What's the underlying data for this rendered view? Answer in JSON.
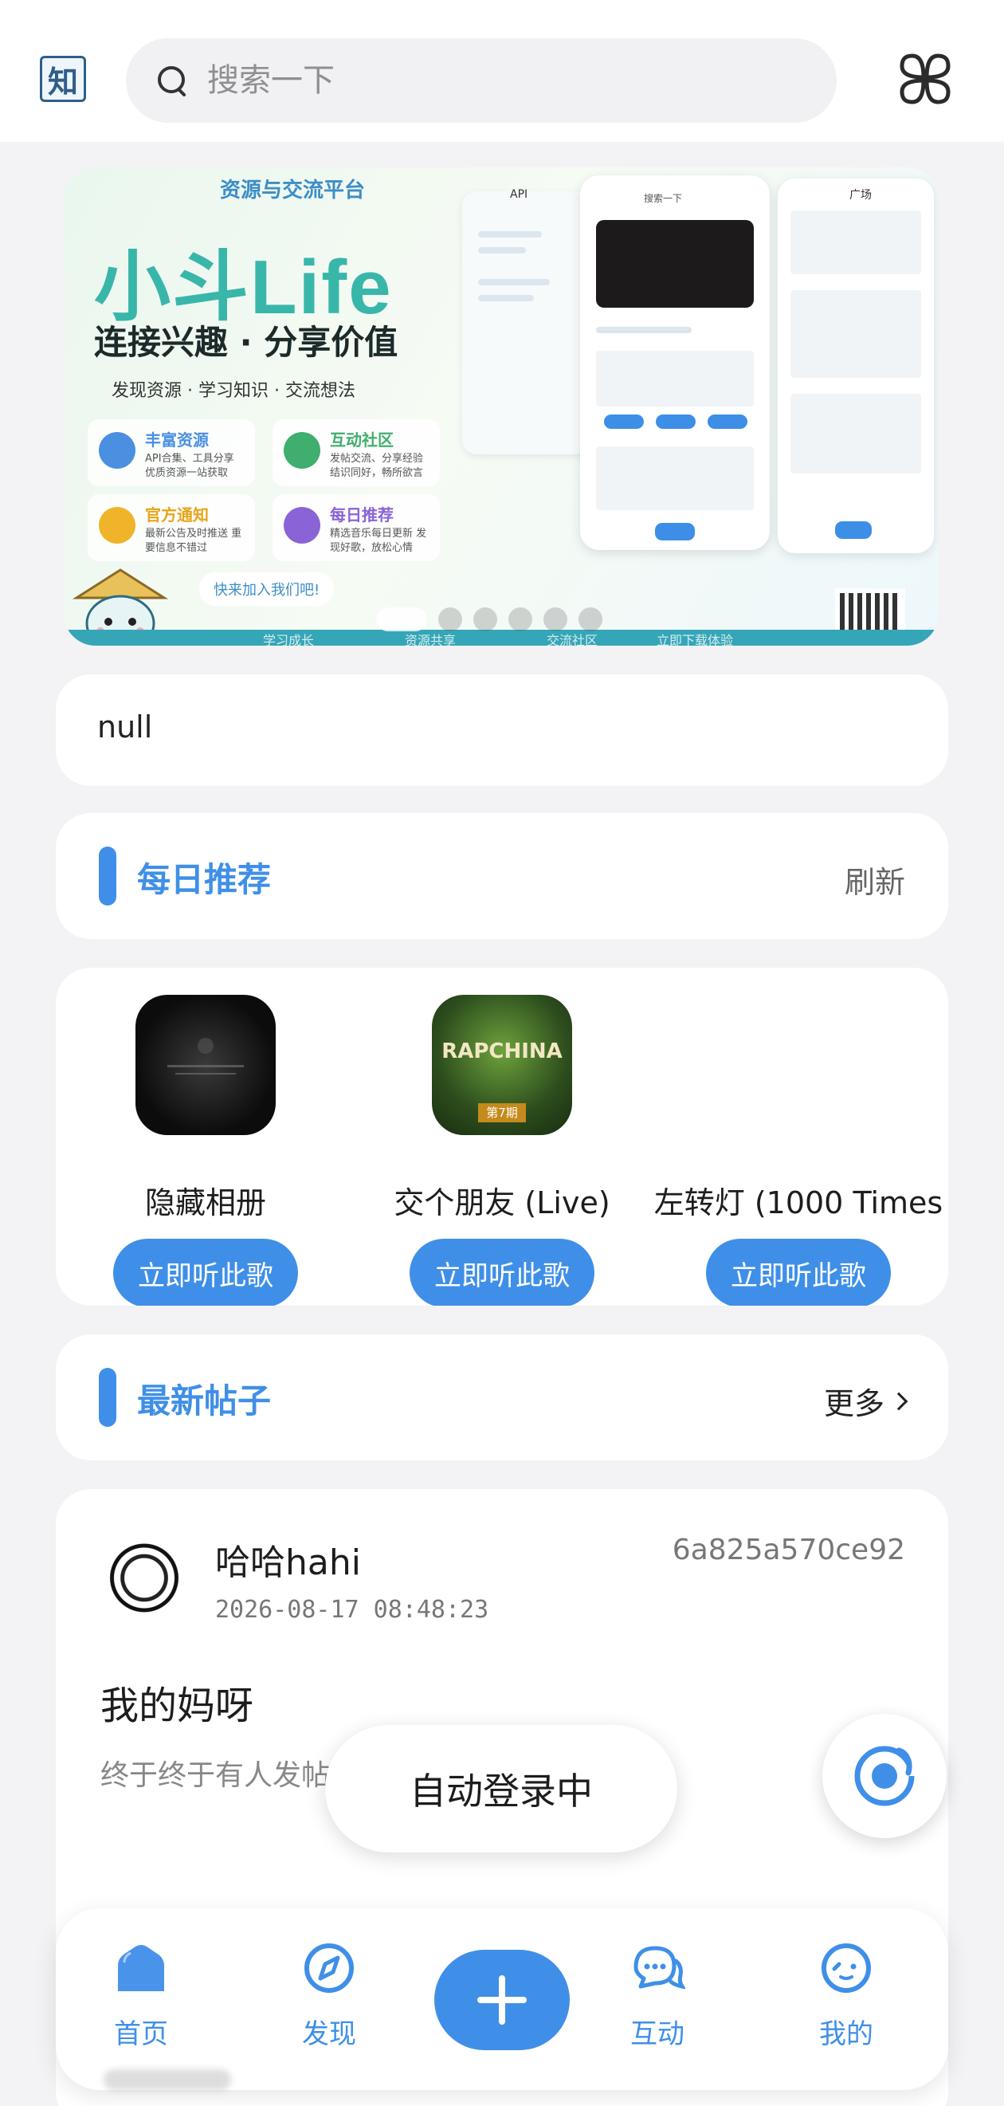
{
  "header": {
    "logo_text": "知",
    "search_placeholder": "搜索一下",
    "grid_icon": "grid-icon"
  },
  "banner": {
    "badge": "资源与交流平台",
    "title": "小斗Life",
    "subtitle": "连接兴趣 · 分享价值",
    "tagline": "发现资源 · 学习知识 · 交流想法",
    "features": [
      {
        "title": "丰富资源",
        "desc": "API合集、工具分享 优质资源一站获取",
        "color": "#4a8fe0"
      },
      {
        "title": "互动社区",
        "desc": "发帖交流、分享经验 结识同好，畅所欲言",
        "color": "#3fae6e"
      },
      {
        "title": "官方通知",
        "desc": "最新公告及时推送 重要信息不错过",
        "color": "#f0b42a"
      },
      {
        "title": "每日推荐",
        "desc": "精选音乐每日更新 发现好歌，放松心情",
        "color": "#8a63d6"
      }
    ],
    "cta": "快来加入我们吧!",
    "bottom_items": [
      "学习成长",
      "资源共享",
      "交流社区",
      "立即下载体验"
    ],
    "phone_labels": {
      "api": "API",
      "square": "广场",
      "search": "搜索一下"
    },
    "slide_count": 6,
    "active_slide": 0
  },
  "notice": {
    "text": "null"
  },
  "daily": {
    "title": "每日推荐",
    "action": "刷新",
    "songs": [
      {
        "name": "隐藏相册",
        "button": "立即听此歌"
      },
      {
        "name": "交个朋友 (Live)",
        "button": "立即听此歌",
        "cover_text": "RAPCHINA",
        "cover_badge": "第7期"
      },
      {
        "name": "左转灯 (1000 Times",
        "button": "立即听此歌"
      }
    ]
  },
  "latest": {
    "title": "最新帖子",
    "action": "更多"
  },
  "post": {
    "username": "哈哈hahi",
    "time": "2026-08-17 08:48:23",
    "id": "6a825a570ce92",
    "title": "我的妈呀",
    "excerpt": "终于终于有人发帖"
  },
  "toast": {
    "text": "自动登录中"
  },
  "nav": {
    "items": [
      {
        "label": "首页",
        "icon": "home-icon"
      },
      {
        "label": "发现",
        "icon": "compass-icon"
      },
      {
        "label": "互动",
        "icon": "chat-icon"
      },
      {
        "label": "我的",
        "icon": "profile-icon"
      }
    ],
    "add_icon": "plus-icon"
  },
  "colors": {
    "accent": "#3f8fe8",
    "background": "#f3f3f5",
    "card": "#ffffff"
  }
}
